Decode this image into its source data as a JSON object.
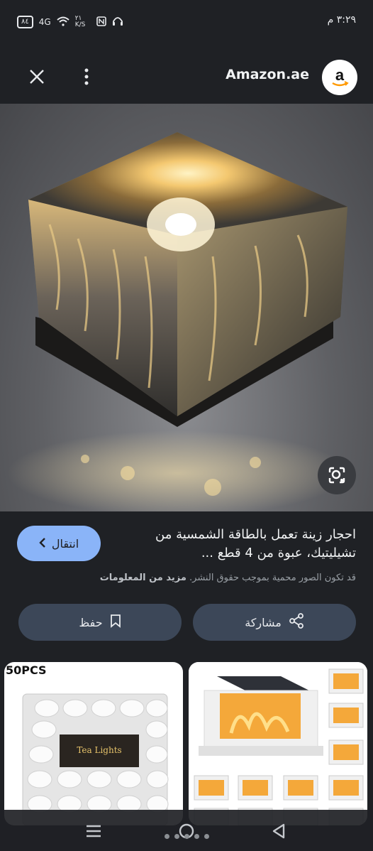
{
  "status": {
    "time": "٣:٢٩ م",
    "battery": "٨٤",
    "network": "4G",
    "speed": "٢١ K/S"
  },
  "topbar": {
    "site_name": "Amazon.ae",
    "logo_letter": "a"
  },
  "result": {
    "title": "احجار زينة تعمل بالطاقة الشمسية من تشيليتيك، عبوة من 4 قطع ...",
    "visit_label": "انتقال",
    "copyright_text": "قد تكون الصور محمية بموجب حقوق النشر.",
    "more_info_label": "مزيد من المعلومات",
    "share_label": "مشاركة",
    "save_label": "حفظ"
  },
  "thumbnails": {
    "left_caption": "50PCS",
    "left_product_label": "Tea Lights"
  },
  "colors": {
    "background": "#1f2125",
    "accent": "#8ab4f8",
    "button_bg": "#3c4758"
  }
}
